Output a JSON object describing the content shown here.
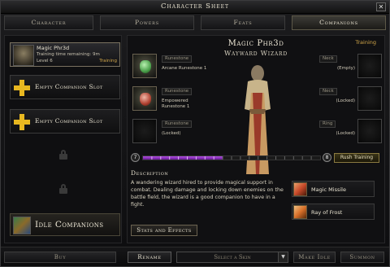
{
  "window": {
    "title": "Character Sheet",
    "close_glyph": "✕"
  },
  "tabs": [
    {
      "label": "Character",
      "active": false
    },
    {
      "label": "Powers",
      "active": false
    },
    {
      "label": "Feats",
      "active": false
    },
    {
      "label": "Companions",
      "active": true
    }
  ],
  "companion_list": {
    "selected": {
      "name": "Magic Phr3d",
      "training_text": "Training time remaining: 9m",
      "level": "Level 6",
      "status": "Training"
    },
    "empty_slots": [
      "Empty Companion Slot",
      "Empty Companion Slot"
    ],
    "idle_label": "Idle Companions"
  },
  "hero": {
    "name": "Magic Phr3d",
    "class": "Wayward Wizard",
    "status": "Training"
  },
  "left_equipment": [
    {
      "tag": "Runestone",
      "label": "Arcane Runestone 1",
      "gem_color": "#6ad06a"
    },
    {
      "tag": "Runestone",
      "label": "Empowered Runestone 1",
      "gem_color": "#d0503a"
    },
    {
      "tag": "Runestone",
      "label": "(Locked)",
      "gem_color": null
    }
  ],
  "right_equipment": [
    {
      "tag": "Neck",
      "label": "(Empty)"
    },
    {
      "tag": "Neck",
      "label": "(Locked)"
    },
    {
      "tag": "Ring",
      "label": "(Locked)"
    }
  ],
  "progress": {
    "current_rank": "7",
    "next_rank": "8",
    "fraction": 0.45,
    "button": "Rush Training"
  },
  "description": {
    "header": "Description",
    "text": "A wandering wizard hired to provide magical support in combat. Dealing damage and locking down enemies on the battle field, the wizard is a good companion to have in a fight."
  },
  "powers": [
    {
      "label": "Magic Missile",
      "icon": "magic-missile-icon",
      "color": "#c84a2a"
    },
    {
      "label": "Ray of Frost",
      "icon": "ray-of-frost-icon",
      "color": "#d8702a"
    }
  ],
  "stats_button": "Stats and Effects",
  "bottom": {
    "buy": "Buy",
    "rename": "Rename",
    "skin_placeholder": "Select a Skin",
    "make_idle": "Make Idle",
    "summon": "Summon"
  },
  "colors": {
    "accent_gold": "#d4a84a",
    "xp_purple": "#9a3ad0",
    "plus_yellow": "#e8b820"
  }
}
